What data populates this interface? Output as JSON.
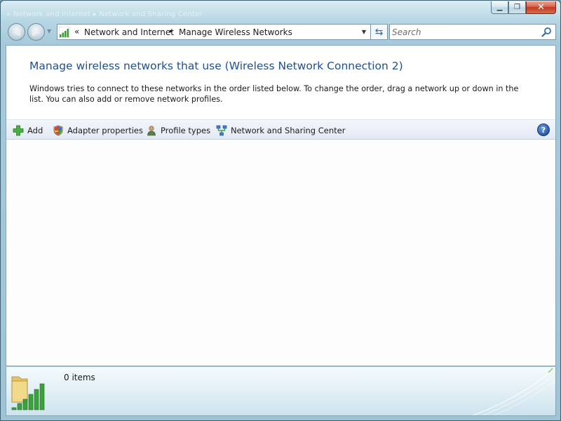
{
  "titlebar": {
    "ghost_title": "«  Network and Internet  ▸  Network and Sharing Center",
    "minimize_symbol": "▁",
    "maximize_symbol": "❐",
    "close_symbol": "✕"
  },
  "nav": {
    "back_symbol": "◀",
    "forward_symbol": "▶",
    "recent_symbol": "▼",
    "address_icon": "signal-bars-icon",
    "address_overflow": "«",
    "breadcrumbs": [
      "Network and Internet",
      "Manage Wireless Networks"
    ],
    "crumb_separator": "▸",
    "address_dropdown_symbol": "▼",
    "refresh_icon": "refresh-icon",
    "refresh_symbol": "⇆",
    "search_placeholder": "Search",
    "search_icon": "search-icon"
  },
  "main": {
    "title": "Manage wireless networks that use (Wireless Network Connection 2)",
    "description": "Windows tries to connect to these networks in the order listed below. To change the order, drag a network up or down in the list. You can also add or remove network profiles."
  },
  "command_bar": {
    "items": [
      {
        "label": "Add",
        "icon": "add-icon"
      },
      {
        "label": "Adapter properties",
        "icon": "shield-icon"
      },
      {
        "label": "Profile types",
        "icon": "user-icon"
      },
      {
        "label": "Network and Sharing Center",
        "icon": "network-icon"
      }
    ],
    "help_symbol": "?"
  },
  "details": {
    "item_count": "0 items",
    "icon": "folder-signal-icon"
  },
  "colors": {
    "title_blue": "#1f4f94",
    "frame_blue": "#a6cadb",
    "add_green": "#3ea23a",
    "close_red": "#c2391f"
  }
}
